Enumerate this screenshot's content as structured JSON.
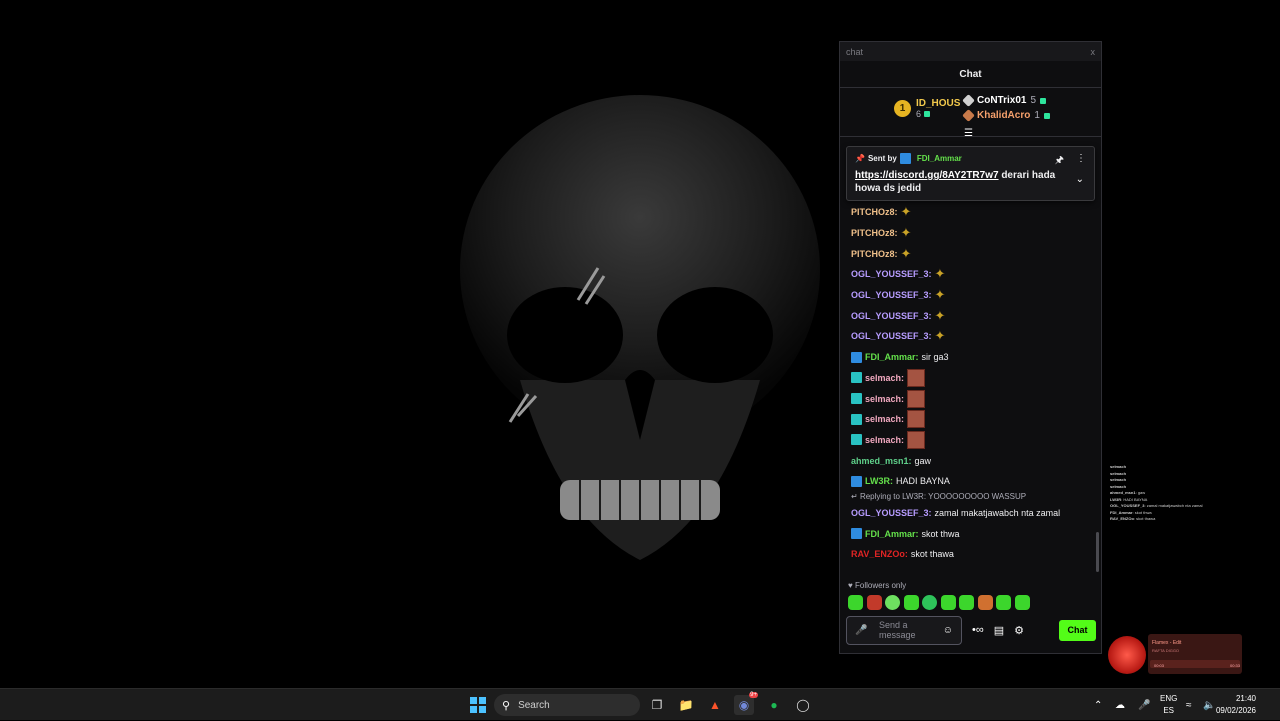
{
  "window": {
    "title": "chat",
    "close": "x"
  },
  "chat": {
    "header": "Chat",
    "leaderboard": {
      "first": {
        "rank": "1",
        "name": "ID_HOUS",
        "points": "6"
      },
      "second": {
        "name": "CoNTrix01",
        "points": "5"
      },
      "third": {
        "name": "KhalidAcro",
        "points": "1"
      }
    },
    "pinned": {
      "sent_by": "Sent by",
      "user": "FDI_Ammar",
      "link": "https://discord.gg/8AY2TR7w7",
      "text": " derari hada howa ds jedid"
    },
    "messages": [
      {
        "user": "PITCHOz8:",
        "color": "#f0c08a",
        "badge": "",
        "text": "",
        "emote": "coins"
      },
      {
        "user": "PITCHOz8:",
        "color": "#f0c08a",
        "badge": "",
        "text": "",
        "emote": "coins"
      },
      {
        "user": "PITCHOz8:",
        "color": "#f0c08a",
        "badge": "",
        "text": "",
        "emote": "coins"
      },
      {
        "user": "OGL_YOUSSEF_3:",
        "color": "#b79cff",
        "badge": "",
        "text": "",
        "emote": "coins"
      },
      {
        "user": "OGL_YOUSSEF_3:",
        "color": "#b79cff",
        "badge": "",
        "text": "",
        "emote": "coins"
      },
      {
        "user": "OGL_YOUSSEF_3:",
        "color": "#b79cff",
        "badge": "",
        "text": "",
        "emote": "coins"
      },
      {
        "user": "OGL_YOUSSEF_3:",
        "color": "#b79cff",
        "badge": "",
        "text": "",
        "emote": "coins"
      },
      {
        "user": "FDI_Ammar:",
        "color": "#64e04b",
        "badge": "blue",
        "text": "sir ga3",
        "emote": ""
      },
      {
        "user": "selmach:",
        "color": "#f2a9c0",
        "badge": "teal",
        "text": "",
        "emote": "face"
      },
      {
        "user": "selmach:",
        "color": "#f2a9c0",
        "badge": "teal",
        "text": "",
        "emote": "face"
      },
      {
        "user": "selmach:",
        "color": "#f2a9c0",
        "badge": "teal",
        "text": "",
        "emote": "face"
      },
      {
        "user": "selmach:",
        "color": "#f2a9c0",
        "badge": "teal",
        "text": "",
        "emote": "face"
      },
      {
        "user": "ahmed_msn1:",
        "color": "#5fd08a",
        "badge": "",
        "text": "gaw",
        "emote": ""
      },
      {
        "user": "LW3R:",
        "color": "#64e04b",
        "badge": "blue",
        "text": "HADI BAYNA",
        "emote": ""
      }
    ],
    "reply_to": "Replying to LW3R: YOOOOOOOOO WASSUP",
    "messages2": [
      {
        "user": "OGL_YOUSSEF_3:",
        "color": "#b79cff",
        "badge": "",
        "text": "zamal makatjawabch nta zamal"
      },
      {
        "user": "FDI_Ammar:",
        "color": "#64e04b",
        "badge": "blue",
        "text": "skot thwa"
      },
      {
        "user": "RAV_ENZOo:",
        "color": "#e02424",
        "badge": "",
        "text": "skot thawa"
      }
    ],
    "followers_only": "Followers only",
    "input_placeholder": "Send a message",
    "chat_button": "Chat"
  },
  "mini_chat": [
    {
      "user": "selmach",
      "text": ""
    },
    {
      "user": "selmach",
      "text": ""
    },
    {
      "user": "selmach",
      "text": ""
    },
    {
      "user": "selmach",
      "text": ""
    },
    {
      "user": "ahmed_msn1",
      "text": "gaw"
    },
    {
      "user": "LW3R",
      "text": "HADI BAYNA"
    },
    {
      "user": "OGL_YOUSSEF_3",
      "text": "zamal makatjawabch nta zamal"
    },
    {
      "user": "FDI_Ammar",
      "text": "skot thwa"
    },
    {
      "user": "RAV_ENZOo",
      "text": "skot thawa"
    }
  ],
  "media": {
    "title": "Flamex - Edit",
    "artist": "RAFTA DIGGO",
    "elapsed": "00:03",
    "total": "00:33"
  },
  "taskbar": {
    "search_label": "Search",
    "discord_badge": "9+",
    "lang_top": "ENG",
    "lang_bottom": "ES",
    "time": "21:40",
    "date": "09/02/2026"
  }
}
